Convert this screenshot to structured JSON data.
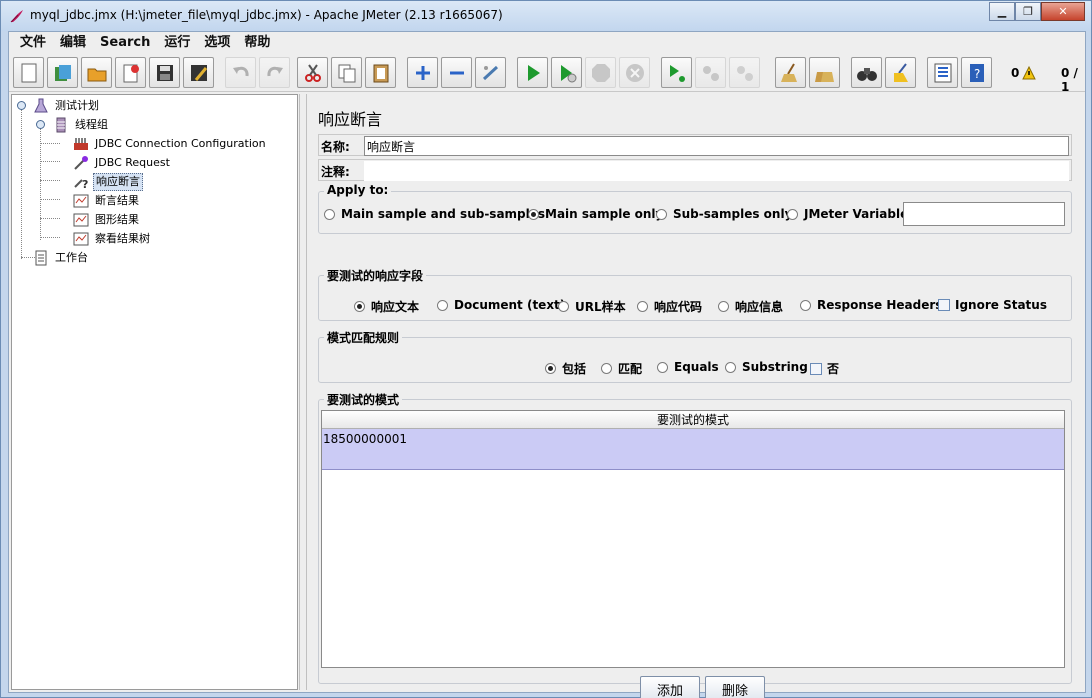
{
  "window": {
    "title": "myql_jdbc.jmx (H:\\jmeter_file\\myql_jdbc.jmx) - Apache JMeter (2.13 r1665067)",
    "minimize": "▁",
    "restore": "❐",
    "close": "✕"
  },
  "menu": {
    "items": [
      "文件",
      "编辑",
      "Search",
      "运行",
      "选项",
      "帮助"
    ]
  },
  "toolbar": {
    "error_count": "0",
    "threads": "0 / 1"
  },
  "tree": {
    "items": [
      {
        "label": "测试计划"
      },
      {
        "label": "线程组"
      },
      {
        "label": "JDBC Connection Configuration"
      },
      {
        "label": "JDBC Request"
      },
      {
        "label": "响应断言"
      },
      {
        "label": "断言结果"
      },
      {
        "label": "图形结果"
      },
      {
        "label": "察看结果树"
      },
      {
        "label": "工作台"
      }
    ]
  },
  "assertion": {
    "title": "响应断言",
    "name_label": "名称:",
    "name_value": "响应断言",
    "comment_label": "注释:",
    "comment_value": "",
    "apply_to": {
      "legend": "Apply to:",
      "options": [
        "Main sample and sub-samples",
        "Main sample only",
        "Sub-samples only",
        "JMeter Variable"
      ],
      "selected": "Main sample only",
      "variable_value": ""
    },
    "response_field": {
      "legend": "要测试的响应字段",
      "options": [
        "响应文本",
        "Document (text)",
        "URL样本",
        "响应代码",
        "响应信息",
        "Response Headers"
      ],
      "selected": "响应文本",
      "ignore_status": "Ignore Status"
    },
    "pattern_rules": {
      "legend": "模式匹配规则",
      "options": [
        "包括",
        "匹配",
        "Equals",
        "Substring"
      ],
      "selected": "包括",
      "not_label": "否"
    },
    "patterns": {
      "legend": "要测试的模式",
      "column": "要测试的模式",
      "rows": [
        "18500000001"
      ]
    },
    "add_button": "添加",
    "delete_button": "删除"
  }
}
